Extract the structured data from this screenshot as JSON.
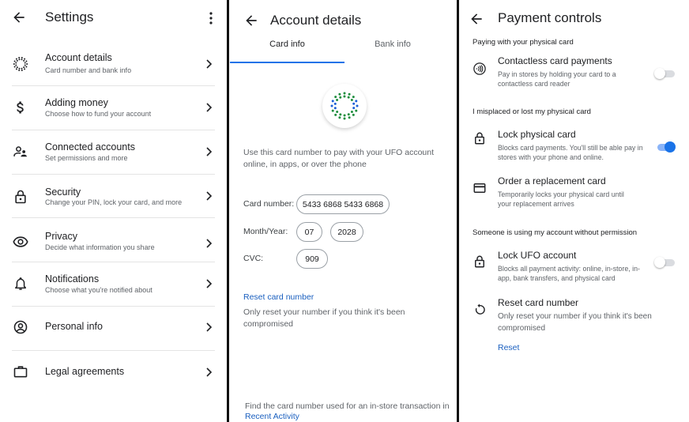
{
  "settings": {
    "title": "Settings",
    "items": [
      {
        "label": "Account details",
        "sub": "Card number and bank info",
        "icon": "ufo-logo-icon"
      },
      {
        "label": "Adding money",
        "sub": "Choose how to fund your account",
        "icon": "dollar-icon"
      },
      {
        "label": "Connected accounts",
        "sub": "Set permissions and more",
        "icon": "people-icon"
      },
      {
        "label": "Security",
        "sub": "Change your PIN, lock your card, and more",
        "icon": "lock-icon"
      },
      {
        "label": "Privacy",
        "sub": "Decide what information you share",
        "icon": "eye-icon"
      },
      {
        "label": "Notifications",
        "sub": "Choose what you're notified about",
        "icon": "bell-icon"
      },
      {
        "label": "Personal info",
        "sub": "",
        "icon": "account-circle-icon"
      },
      {
        "label": "Legal agreements",
        "sub": "",
        "icon": "briefcase-icon"
      }
    ]
  },
  "account_details": {
    "title": "Account details",
    "tabs": [
      {
        "label": "Card info",
        "active": true
      },
      {
        "label": "Bank info",
        "active": false
      }
    ],
    "description": "Use this card number to pay with your UFO account online, in apps, or over the phone",
    "fields": {
      "card_number_label": "Card number:",
      "card_number": "5433 6868 5433 6868",
      "month_year_label": "Month/Year:",
      "month": "07",
      "year": "2028",
      "cvc_label": "CVC:",
      "cvc": "909"
    },
    "reset_link": "Reset card number",
    "reset_note": "Only reset your number if you think it's been compromised",
    "footer_text": "Find the card number used for an in-store transaction in",
    "footer_link": "Recent Activity",
    "accent_color": "#1a73e8"
  },
  "payment_controls": {
    "title": "Payment controls",
    "sections": [
      {
        "header": "Paying with your physical card",
        "items": [
          {
            "label": "Contactless card payments",
            "sub": "Pay in stores by holding your card to a contactless card reader",
            "toggle": false
          }
        ]
      },
      {
        "header": "I misplaced or lost my physical card",
        "items": [
          {
            "label": "Lock physical card",
            "sub": "Blocks card payments. You'll still be able pay in stores with your phone and online.",
            "toggle": true
          },
          {
            "label": "Order a replacement card",
            "sub": "Temporarily locks your physical card until your replacement arrives"
          }
        ]
      },
      {
        "header": "Someone is using my account without permission",
        "items": [
          {
            "label": "Lock UFO account",
            "sub": "Blocks all payment activity: online, in-store, in-app, bank transfers, and physical card",
            "toggle": false
          },
          {
            "label": "Reset card number",
            "sub": "Only reset your number if you think it's been compromised",
            "action": "Reset"
          }
        ]
      }
    ]
  }
}
